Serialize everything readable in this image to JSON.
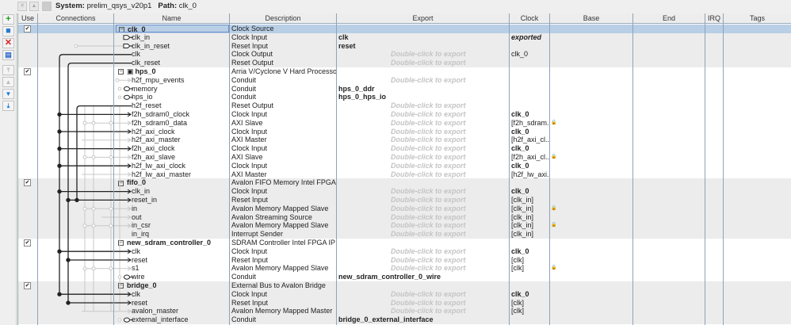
{
  "system": {
    "label": "System:",
    "name": "prelim_qsys_v20p1",
    "path_label": "Path:",
    "path": "clk_0"
  },
  "toolbar": [
    "add-icon",
    "connect-icon",
    "remove-icon",
    "edit-icon",
    "move-top-icon",
    "move-up-icon",
    "move-down-icon",
    "move-bottom-icon"
  ],
  "columns": [
    "Use",
    "Connections",
    "Name",
    "Description",
    "Export",
    "Clock",
    "Base",
    "End",
    "IRQ",
    "Tags"
  ],
  "placeholder": "Double-click to export",
  "components": [
    {
      "name": "clk_0",
      "description": "Clock Source",
      "use": true,
      "children": [
        {
          "name": "clk_in",
          "description": "Clock Input",
          "export": "clk",
          "clock": "exported",
          "clock_style": "ital"
        },
        {
          "name": "clk_in_reset",
          "description": "Reset Input",
          "export": "reset"
        },
        {
          "name": "clk",
          "description": "Clock Output",
          "clock": "clk_0",
          "clock_style": "plain"
        },
        {
          "name": "clk_reset",
          "description": "Reset Output"
        }
      ]
    },
    {
      "name": "hps_0",
      "description": "Arria V/Cyclone V Hard Processor ...",
      "use": true,
      "icon": true,
      "children": [
        {
          "name": "h2f_mpu_events",
          "description": "Conduit"
        },
        {
          "name": "memory",
          "description": "Conduit",
          "export": "hps_0_ddr"
        },
        {
          "name": "hps_io",
          "description": "Conduit",
          "export": "hps_0_hps_io"
        },
        {
          "name": "h2f_reset",
          "description": "Reset Output"
        },
        {
          "name": "f2h_sdram0_clock",
          "description": "Clock Input",
          "clock": "clk_0",
          "clock_style": "bold"
        },
        {
          "name": "f2h_sdram0_data",
          "description": "AXI Slave",
          "clock": "[f2h_sdram...",
          "lock": true
        },
        {
          "name": "h2f_axi_clock",
          "description": "Clock Input",
          "clock": "clk_0",
          "clock_style": "bold"
        },
        {
          "name": "h2f_axi_master",
          "description": "AXI Master",
          "clock": "[h2f_axi_cl..."
        },
        {
          "name": "f2h_axi_clock",
          "description": "Clock Input",
          "clock": "clk_0",
          "clock_style": "bold"
        },
        {
          "name": "f2h_axi_slave",
          "description": "AXI Slave",
          "clock": "[f2h_axi_cl...",
          "lock": true
        },
        {
          "name": "h2f_lw_axi_clock",
          "description": "Clock Input",
          "clock": "clk_0",
          "clock_style": "bold"
        },
        {
          "name": "h2f_lw_axi_master",
          "description": "AXI Master",
          "clock": "[h2f_lw_axi..."
        }
      ]
    },
    {
      "name": "fifo_0",
      "description": "Avalon FIFO Memory Intel FPGA IP",
      "use": true,
      "children": [
        {
          "name": "clk_in",
          "description": "Clock Input",
          "clock": "clk_0",
          "clock_style": "bold"
        },
        {
          "name": "reset_in",
          "description": "Reset Input",
          "clock": "[clk_in]"
        },
        {
          "name": "in",
          "description": "Avalon Memory Mapped Slave",
          "clock": "[clk_in]",
          "lock": true
        },
        {
          "name": "out",
          "description": "Avalon Streaming Source",
          "clock": "[clk_in]"
        },
        {
          "name": "in_csr",
          "description": "Avalon Memory Mapped Slave",
          "clock": "[clk_in]",
          "lock": true
        },
        {
          "name": "in_irq",
          "description": "Interrupt Sender",
          "clock": "[clk_in]"
        }
      ]
    },
    {
      "name": "new_sdram_controller_0",
      "description": "SDRAM Controller Intel FPGA IP",
      "use": true,
      "children": [
        {
          "name": "clk",
          "description": "Clock Input",
          "clock": "clk_0",
          "clock_style": "bold"
        },
        {
          "name": "reset",
          "description": "Reset Input",
          "clock": "[clk]"
        },
        {
          "name": "s1",
          "description": "Avalon Memory Mapped Slave",
          "clock": "[clk]",
          "lock": true
        },
        {
          "name": "wire",
          "description": "Conduit",
          "export": "new_sdram_controller_0_wire"
        }
      ]
    },
    {
      "name": "bridge_0",
      "description": "External Bus to Avalon Bridge",
      "use": true,
      "children": [
        {
          "name": "clk",
          "description": "Clock Input",
          "clock": "clk_0",
          "clock_style": "bold"
        },
        {
          "name": "reset",
          "description": "Reset Input",
          "clock": "[clk]"
        },
        {
          "name": "avalon_master",
          "description": "Avalon Memory Mapped Master",
          "clock": "[clk]"
        },
        {
          "name": "external_interface",
          "description": "Conduit",
          "export": "bridge_0_external_interface"
        }
      ]
    }
  ]
}
